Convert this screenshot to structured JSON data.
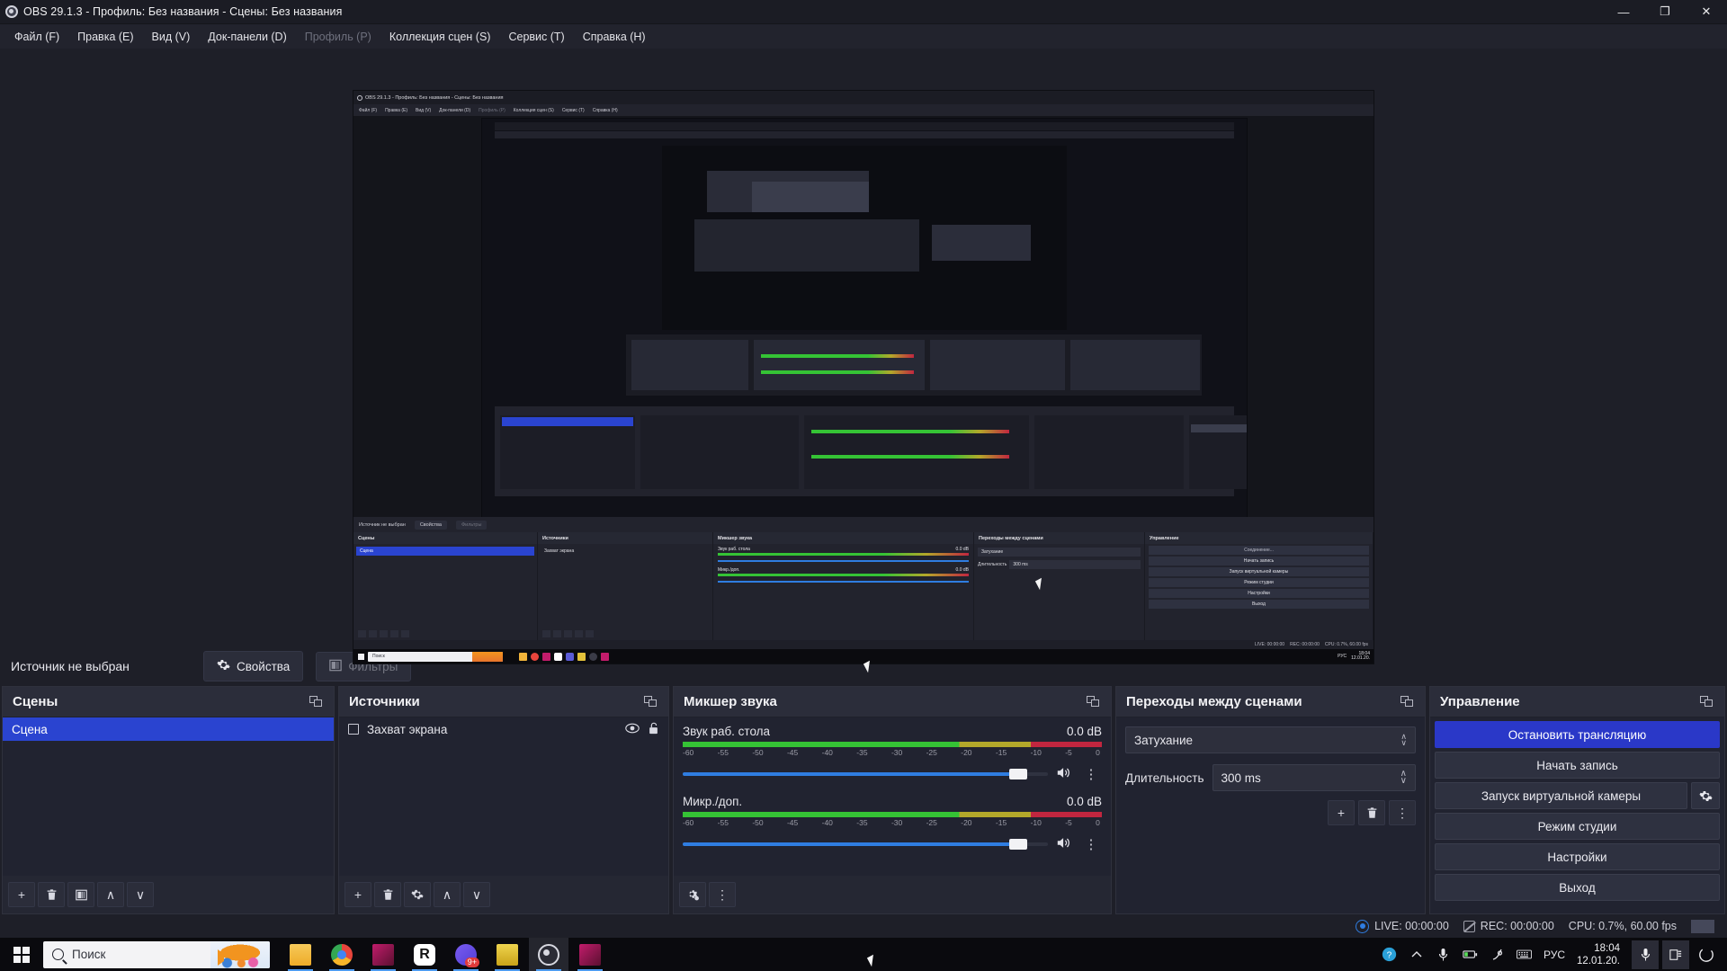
{
  "window": {
    "title": "OBS 29.1.3 - Профиль: Без названия - Сцены: Без названия",
    "minimize": "—",
    "maximize": "❐",
    "close": "✕"
  },
  "menubar": [
    {
      "label": "Файл (F)",
      "disabled": false
    },
    {
      "label": "Правка (E)",
      "disabled": false
    },
    {
      "label": "Вид (V)",
      "disabled": false
    },
    {
      "label": "Док-панели (D)",
      "disabled": false
    },
    {
      "label": "Профиль (P)",
      "disabled": true
    },
    {
      "label": "Коллекция сцен (S)",
      "disabled": false
    },
    {
      "label": "Сервис (T)",
      "disabled": false
    },
    {
      "label": "Справка (H)",
      "disabled": false
    }
  ],
  "source_toolbar": {
    "label": "Источник не выбран",
    "properties": "Свойства",
    "filters": "Фильтры"
  },
  "scenes": {
    "title": "Сцены",
    "items": [
      {
        "name": "Сцена",
        "selected": true
      }
    ],
    "buttons": [
      "+",
      "🗑",
      "⧉",
      "∧",
      "∨"
    ]
  },
  "sources": {
    "title": "Источники",
    "items": [
      {
        "name": "Захват экрана",
        "visible": true,
        "locked": false
      }
    ],
    "buttons": [
      "+",
      "🗑",
      "⚙",
      "∧",
      "∨"
    ]
  },
  "mixer": {
    "title": "Микшер звука",
    "scale": [
      "-60",
      "-55",
      "-50",
      "-45",
      "-40",
      "-35",
      "-30",
      "-25",
      "-20",
      "-15",
      "-10",
      "-5",
      "0"
    ],
    "channels": [
      {
        "name": "Звук раб. стола",
        "db": "0.0 dB",
        "level_pct": 26,
        "volume_pct": 92
      },
      {
        "name": "Микр./доп.",
        "db": "0.0 dB",
        "level_pct": 1,
        "volume_pct": 92
      }
    ]
  },
  "transitions": {
    "title": "Переходы между сценами",
    "selected": "Затухание",
    "duration_label": "Длительность",
    "duration_value": "300 ms"
  },
  "controls": {
    "title": "Управление",
    "buttons": [
      {
        "label": "Остановить трансляцию",
        "primary": true,
        "gear": false
      },
      {
        "label": "Начать запись",
        "primary": false,
        "gear": false
      },
      {
        "label": "Запуск виртуальной камеры",
        "primary": false,
        "gear": true
      },
      {
        "label": "Режим студии",
        "primary": false,
        "gear": false
      },
      {
        "label": "Настройки",
        "primary": false,
        "gear": false
      },
      {
        "label": "Выход",
        "primary": false,
        "gear": false
      }
    ]
  },
  "statusbar": {
    "live": "LIVE: 00:00:00",
    "rec": "REC: 00:00:00",
    "cpu": "CPU: 0.7%, 60.00 fps"
  },
  "taskbar": {
    "search_placeholder": "Поиск",
    "language": "РУС",
    "time": "18:04",
    "date": "12.01.20.",
    "apps": [
      {
        "name": "explorer",
        "color": "#f2b43a"
      },
      {
        "name": "chrome",
        "color": "#e8453c"
      },
      {
        "name": "media-app",
        "color": "#c21c6b"
      },
      {
        "name": "r-app",
        "color": "#ffffff"
      },
      {
        "name": "discord",
        "color": "#5b5bd6",
        "badge": "9+"
      },
      {
        "name": "locker-app",
        "color": "#e3c13a"
      },
      {
        "name": "obs",
        "color": "#2c2d38",
        "active": true
      },
      {
        "name": "media-app-2",
        "color": "#c21c6b"
      }
    ]
  },
  "nested": {
    "title": "OBS 29.1.3 - Профиль: Без названия - Сцены: Без названия",
    "menubar": [
      "Файл (F)",
      "Правка (E)",
      "Вид (V)",
      "Док-панели (D)",
      "Профиль (P)",
      "Коллекция сцен (S)",
      "Сервис (T)",
      "Справка (H)"
    ],
    "source_toolbar": {
      "label": "Источник не выбран",
      "properties": "Свойства",
      "filters": "Фильтры"
    },
    "docks": [
      "Сцены",
      "Источники",
      "Микшер звука",
      "Переходы между сценами",
      "Управление"
    ],
    "scene_item": "Сцена",
    "source_item": "Захват экрана",
    "channels": [
      {
        "name": "Звук раб. стола",
        "db": "0.0 dB"
      },
      {
        "name": "Микр./доп.",
        "db": "0.0 dB"
      }
    ],
    "transition": "Затухание",
    "duration_label": "Длительность",
    "duration_value": "300 ms",
    "controls": [
      "Соединение...",
      "Начать запись",
      "Запуск виртуальной камеры",
      "Режим студии",
      "Настройки",
      "Выход"
    ],
    "status": {
      "live": "LIVE: 00:00:00",
      "rec": "REC: 00:00:00",
      "cpu": "CPU: 0.7%, 60.00 fps"
    },
    "taskbar": {
      "search": "Поиск",
      "lang": "РУС",
      "time": "18:04",
      "date": "12.01.20."
    }
  },
  "colors": {
    "accent_blue": "#2a38c8",
    "selection_blue": "#2a44d0",
    "meter_green": "#35c335",
    "meter_yellow": "#b3a82a",
    "meter_red": "#c1263f",
    "panel_bg": "#252733",
    "window_bg": "#1e1f28"
  }
}
